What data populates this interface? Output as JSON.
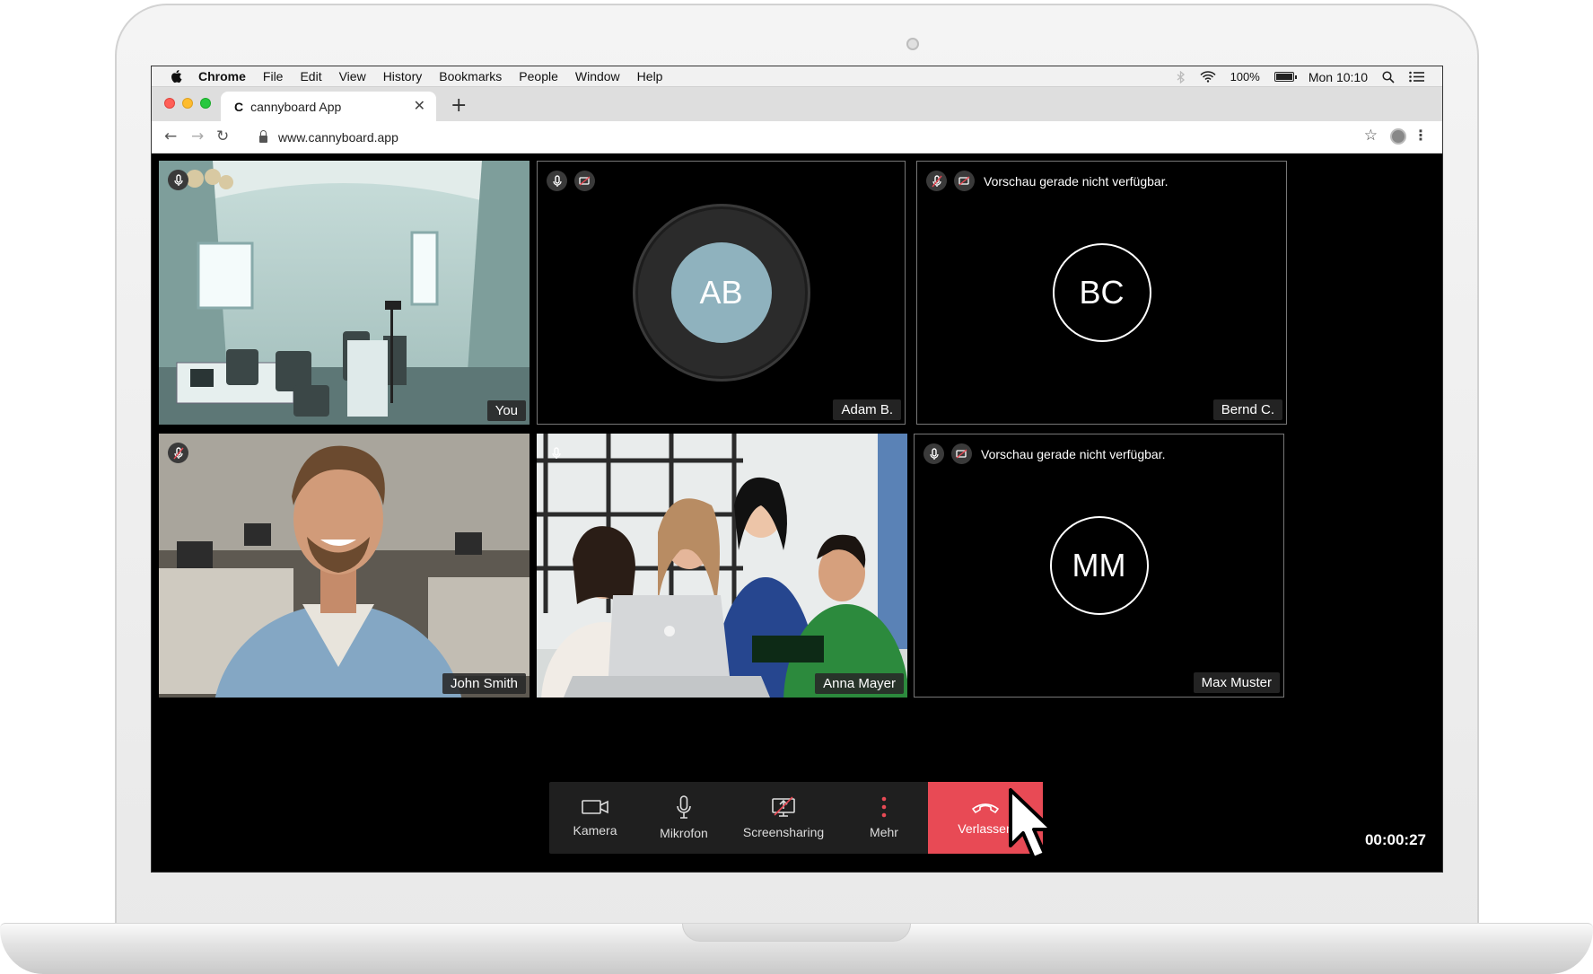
{
  "menubar": {
    "app": "Chrome",
    "items": [
      "File",
      "Edit",
      "View",
      "History",
      "Bookmarks",
      "People",
      "Window",
      "Help"
    ],
    "battery": "100%",
    "clock": "Mon 10:10"
  },
  "browser": {
    "tab_title": "cannyboard App",
    "tab_favicon": "C",
    "url": "www.cannyboard.app"
  },
  "participants": [
    {
      "name": "You",
      "mic": "on",
      "camera": "on"
    },
    {
      "name": "Adam B.",
      "initials": "AB",
      "mic": "on",
      "camera": "off",
      "speaking": true
    },
    {
      "name": "Bernd C.",
      "initials": "BC",
      "mic": "muted",
      "camera": "off",
      "notice": "Vorschau gerade nicht verfügbar."
    },
    {
      "name": "John Smith",
      "mic": "muted",
      "camera": "on"
    },
    {
      "name": "Anna Mayer",
      "mic": "on",
      "camera": "on"
    },
    {
      "name": "Max Muster",
      "initials": "MM",
      "mic": "on",
      "camera": "off",
      "notice": "Vorschau gerade nicht verfügbar."
    }
  ],
  "controls": {
    "camera": "Kamera",
    "microphone": "Mikrofon",
    "screensharing": "Screensharing",
    "more": "Mehr",
    "leave": "Verlassen"
  },
  "call_timer": "00:00:27",
  "colors": {
    "leave_button": "#e84a55",
    "speaking_avatar": "#8fb2be",
    "more_icon": "#e84a55"
  }
}
